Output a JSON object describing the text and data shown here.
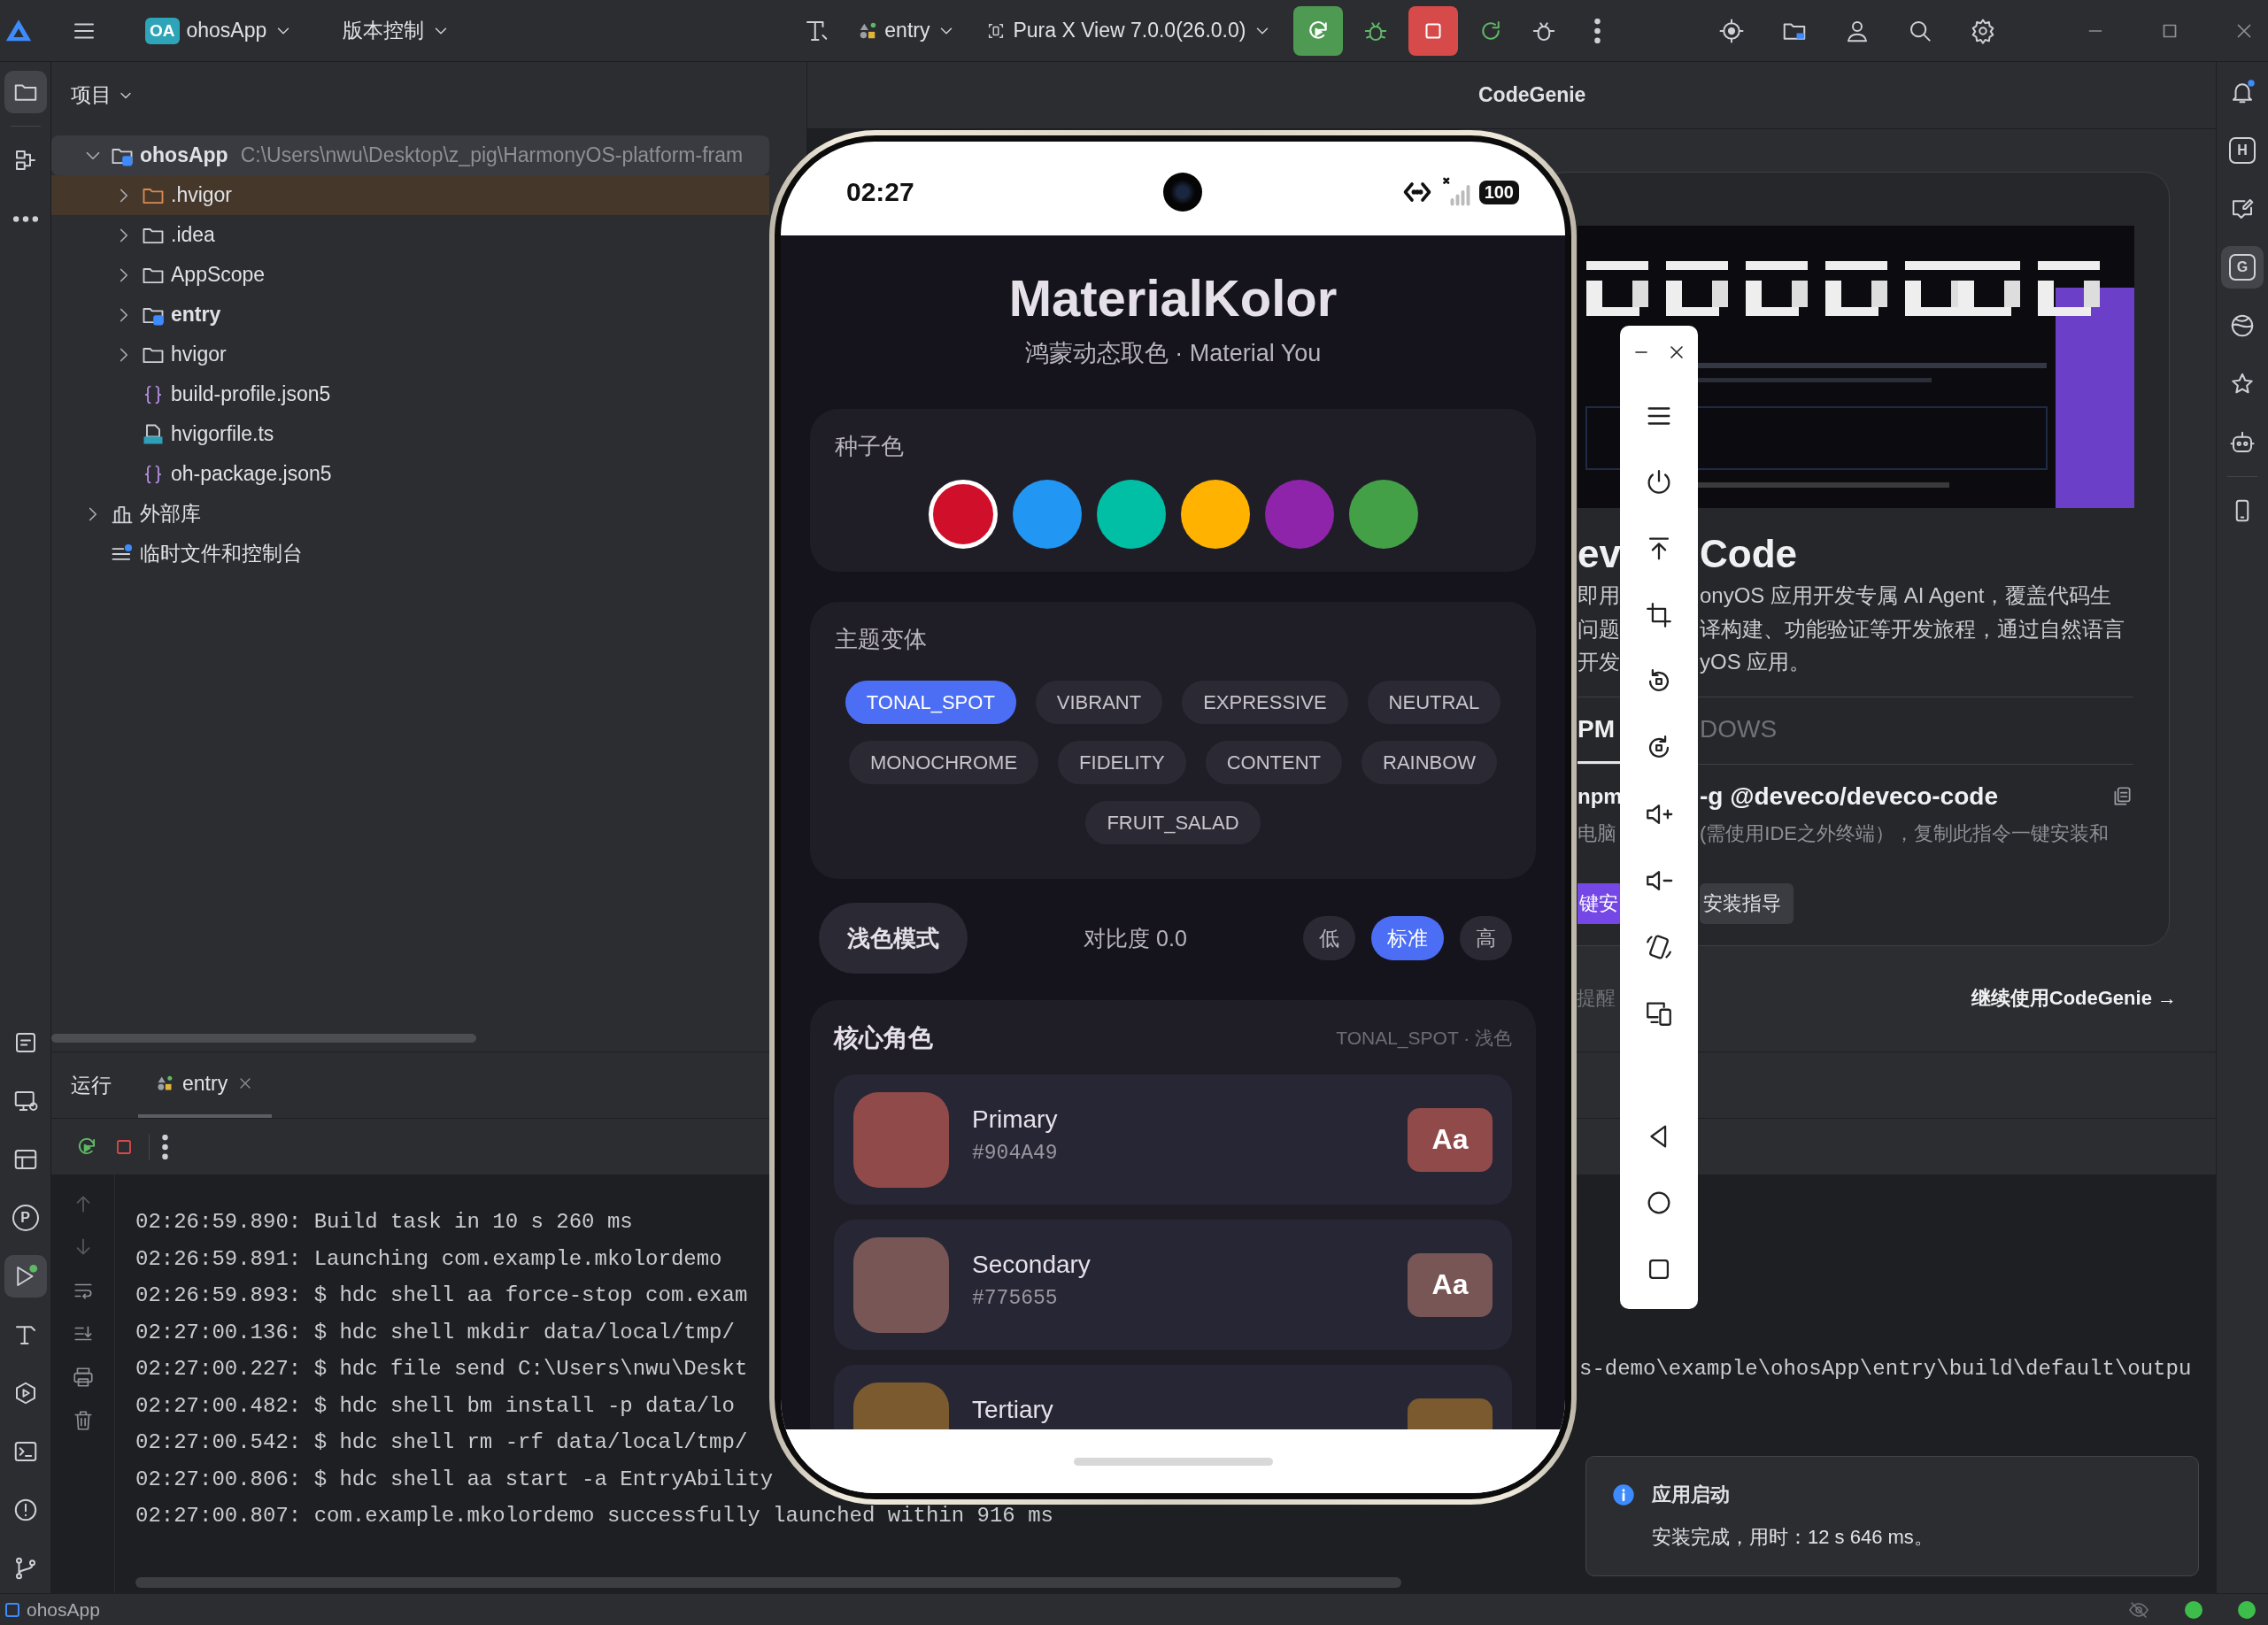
{
  "top_bar": {
    "project_badge": "OA",
    "project": "ohosApp",
    "vcs": "版本控制",
    "run_config": "entry",
    "device": "Pura X View 7.0.0(26.0.0)"
  },
  "left_toolbar": [
    {
      "kind": "folder",
      "selected": true
    },
    {
      "kind": "structure",
      "selected": false
    },
    {
      "kind": "more",
      "selected": false
    }
  ],
  "left_toolbar_bottom": [
    {
      "kind": "notes",
      "selected": false
    },
    {
      "kind": "monitor",
      "selected": false
    },
    {
      "kind": "layout",
      "selected": false
    },
    {
      "kind": "glyph",
      "glyph": "P",
      "selected": false
    },
    {
      "kind": "run",
      "selected": true
    },
    {
      "kind": "hammer",
      "selected": false
    },
    {
      "kind": "hexplay",
      "selected": false
    },
    {
      "kind": "terminal",
      "selected": false
    },
    {
      "kind": "warning",
      "selected": false
    },
    {
      "kind": "git",
      "selected": false
    }
  ],
  "right_toolbar": [
    {
      "kind": "bell",
      "selected": false
    },
    {
      "kind": "glyph",
      "glyph": "H",
      "selected": false
    },
    {
      "kind": "edit",
      "selected": false
    },
    {
      "kind": "glyph",
      "glyph": "G",
      "selected": true
    },
    {
      "kind": "globe",
      "selected": false
    },
    {
      "kind": "star",
      "selected": false
    },
    {
      "kind": "robot",
      "selected": false
    }
  ],
  "right_toolbar_bottom": [
    {
      "kind": "phone",
      "selected": false
    }
  ],
  "project_panel": {
    "title": "项目",
    "tree": [
      {
        "label": "ohosApp",
        "path": "C:\\Users\\nwu\\Desktop\\z_pig\\HarmonyOS-platform-fram",
        "kind": "module",
        "expanded": true,
        "selected": false,
        "children": [
          {
            "label": ".hvigor",
            "kind": "excluded",
            "expanded": false,
            "selected": true
          },
          {
            "label": ".idea",
            "kind": "folder",
            "expanded": false,
            "selected": false
          },
          {
            "label": "AppScope",
            "kind": "folder",
            "expanded": false,
            "selected": false
          },
          {
            "label": "entry",
            "kind": "module",
            "expanded": false,
            "selected": false
          },
          {
            "label": "hvigor",
            "kind": "folder",
            "expanded": false,
            "selected": false
          },
          {
            "label": "build-profile.json5",
            "kind": "json",
            "selected": false
          },
          {
            "label": "hvigorfile.ts",
            "kind": "ts",
            "selected": false
          },
          {
            "label": "oh-package.json5",
            "kind": "json",
            "selected": false
          }
        ]
      },
      {
        "label": "外部库",
        "kind": "library",
        "expanded": false,
        "selected": false
      },
      {
        "label": "临时文件和控制台",
        "kind": "scratch",
        "selected": false
      }
    ]
  },
  "codegenie": {
    "title": "CodeGenie",
    "card": {
      "heading": {
        "left": "ev",
        "right": "Code"
      },
      "description": [
        {
          "left": "即用",
          "right": "onyOS 应用开发专属 AI Agent，覆盖代码生"
        },
        {
          "left": "问题",
          "right": "译构建、功能验证等开发旅程，通过自然语言"
        },
        {
          "left": "开发",
          "right": "yOS 应用。"
        }
      ],
      "install_tabs": [
        {
          "label": "PM",
          "selected": true
        },
        {
          "label": "DOWS",
          "selected": false
        }
      ],
      "command": {
        "left": "npm",
        "right": "-g @deveco/deveco-code"
      },
      "note": {
        "left": "电脑",
        "right": "(需使用IDE之外终端），复制此指令一键安装和"
      },
      "primary_button": "键安",
      "secondary_button": "安装指导"
    },
    "reminder": "提醒",
    "continue_link": "继续使用CodeGenie →"
  },
  "run_panel": {
    "label": "运行",
    "tabs": [
      {
        "label": "entry",
        "selected": true
      }
    ],
    "console": [
      {
        "text": "02:26:59.890: Build task in 10 s 260 ms"
      },
      {
        "text": "02:26:59.891: Launching com.example.mkolordemo"
      },
      {
        "text": "02:26:59.893: $ hdc shell aa force-stop com.exam"
      },
      {
        "text": "02:27:00.136: $ hdc shell mkdir data/local/tmp/"
      },
      {
        "text": "02:27:00.227: $ hdc file send C:\\Users\\nwu\\Deskt",
        "continuation": "s-demo\\example\\ohosApp\\entry\\build\\default\\outpu"
      },
      {
        "text": "02:27:00.482: $ hdc shell bm install -p data/lo"
      },
      {
        "text": "02:27:00.542: $ hdc shell rm -rf data/local/tmp/"
      },
      {
        "text": "02:27:00.806: $ hdc shell aa start -a EntryAbility"
      },
      {
        "text": "02:27:00.807: com.example.mkolordemo successfully launched within 916 ms"
      }
    ]
  },
  "phone": {
    "time": "02:27",
    "battery": "100",
    "app": {
      "title": "MaterialKolor",
      "subtitle": "鸿蒙动态取色 · Material You",
      "seed_section": {
        "label": "种子色",
        "colors": [
          {
            "color": "#d0102a",
            "selected": true
          },
          {
            "color": "#2196f3",
            "selected": false
          },
          {
            "color": "#00bfa5",
            "selected": false
          },
          {
            "color": "#ffb300",
            "selected": false
          },
          {
            "color": "#8e24aa",
            "selected": false
          },
          {
            "color": "#43a047",
            "selected": false
          }
        ]
      },
      "variant_section": {
        "label": "主题变体",
        "variants": [
          {
            "label": "TONAL_SPOT",
            "selected": true
          },
          {
            "label": "VIBRANT",
            "selected": false
          },
          {
            "label": "EXPRESSIVE",
            "selected": false
          },
          {
            "label": "NEUTRAL",
            "selected": false
          },
          {
            "label": "MONOCHROME",
            "selected": false
          },
          {
            "label": "FIDELITY",
            "selected": false
          },
          {
            "label": "CONTENT",
            "selected": false
          },
          {
            "label": "RAINBOW",
            "selected": false
          },
          {
            "label": "FRUIT_SALAD",
            "selected": false
          }
        ]
      },
      "mode_button": "浅色模式",
      "contrast_label": "对比度 0.0",
      "contrast_options": [
        {
          "label": "低",
          "selected": false
        },
        {
          "label": "标准",
          "selected": true
        },
        {
          "label": "高",
          "selected": false
        }
      ],
      "roles_section": {
        "label": "核心角色",
        "meta": "TONAL_SPOT · 浅色",
        "roles": [
          {
            "name": "Primary",
            "hex": "#904A49",
            "color": "#904a49",
            "sample": "Aa"
          },
          {
            "name": "Secondary",
            "hex": "#775655",
            "color": "#775655",
            "sample": "Aa"
          },
          {
            "name": "Tertiary",
            "color": "#7a5a2e"
          }
        ]
      }
    }
  },
  "toast": {
    "title": "应用启动",
    "message": "安装完成，用时：12 s 646 ms。"
  },
  "status_bar": {
    "project": "ohosApp"
  }
}
